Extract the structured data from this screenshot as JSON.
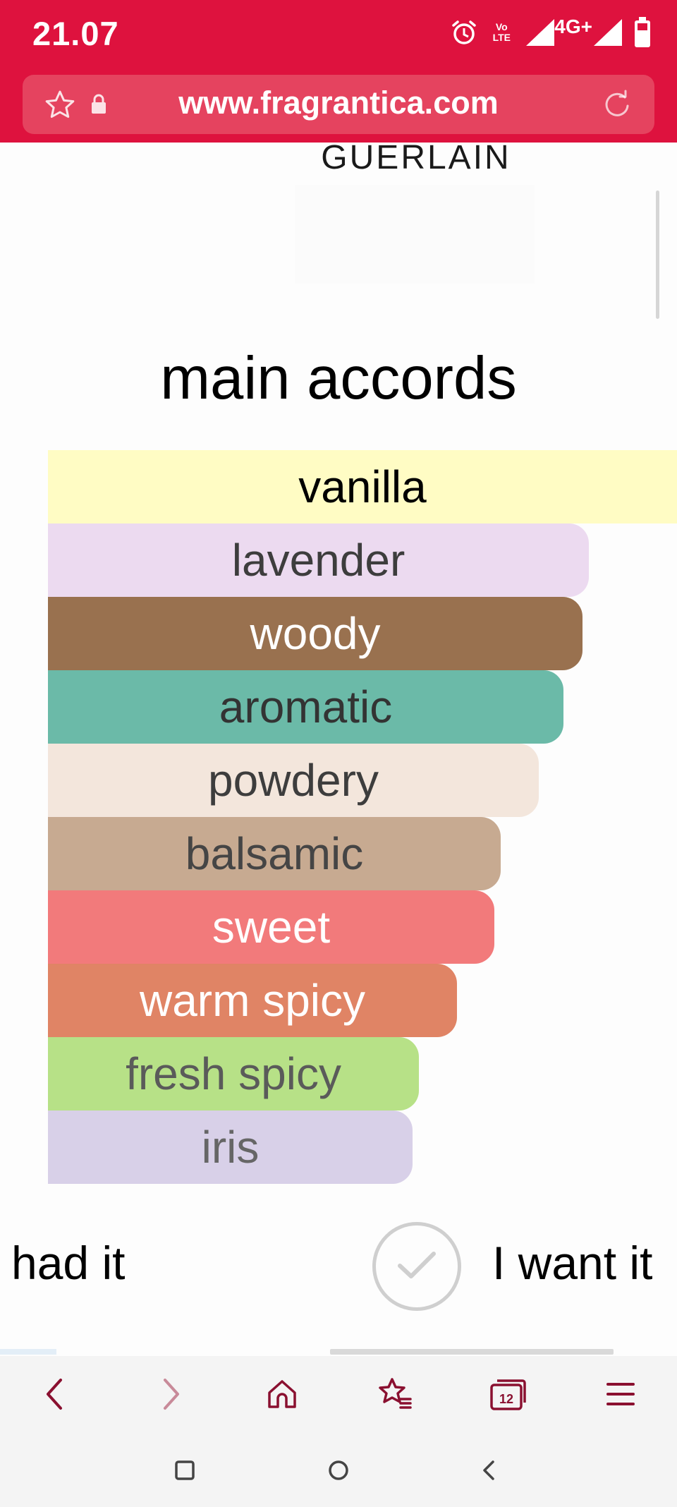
{
  "status_bar": {
    "time": "21.07",
    "network_label": "4G+",
    "volte_label": "Vo LTE",
    "icons": [
      "alarm-icon",
      "volte-icon",
      "signal-icon",
      "signal-icon",
      "battery-icon"
    ]
  },
  "browser": {
    "url": "www.fragrantica.com",
    "icons": [
      "star-icon",
      "lock-icon",
      "reload-icon"
    ]
  },
  "page": {
    "brand": "GUERLAIN",
    "heading": "main accords",
    "accords": [
      {
        "label": "vanilla",
        "level": 1.0,
        "color": "#fffcc4",
        "text_color": "#000000"
      },
      {
        "label": "lavender",
        "level": 0.86,
        "color": "#ecdaf0",
        "text_color": "#3d3d3d"
      },
      {
        "label": "woody",
        "level": 0.85,
        "color": "#99714f",
        "text_color": "#ffffff"
      },
      {
        "label": "aromatic",
        "level": 0.82,
        "color": "#6bbaa8",
        "text_color": "#333333"
      },
      {
        "label": "powdery",
        "level": 0.78,
        "color": "#f3e6dc",
        "text_color": "#3d3d3d"
      },
      {
        "label": "balsamic",
        "level": 0.72,
        "color": "#c7aa91",
        "text_color": "#454545"
      },
      {
        "label": "sweet",
        "level": 0.71,
        "color": "#f27a7b",
        "text_color": "#ffffff"
      },
      {
        "label": "warm spicy",
        "level": 0.65,
        "color": "#e08465",
        "text_color": "#ffffff"
      },
      {
        "label": "fresh spicy",
        "level": 0.59,
        "color": "#b7e187",
        "text_color": "#5a5a5a"
      },
      {
        "label": "iris",
        "level": 0.58,
        "color": "#d8d0e8",
        "text_color": "#666666"
      }
    ],
    "owned_label": "had it",
    "want_label": "I want it"
  },
  "bottom_nav": {
    "icons": [
      "back-icon",
      "forward-icon",
      "home-icon",
      "bookmarks-icon",
      "tabs-icon",
      "menu-icon"
    ],
    "tab_count": "12"
  },
  "system_nav": {
    "icons": [
      "recents-icon",
      "home-circle-icon",
      "system-back-icon"
    ]
  },
  "colors": {
    "brand_red": "#de123e",
    "url_bar": "#e5435f",
    "nav_icon": "#8a1030"
  }
}
